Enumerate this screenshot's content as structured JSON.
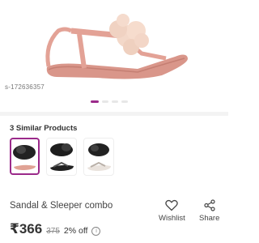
{
  "product": {
    "sku": "s-172636357",
    "title": "Sandal & Sleeper combo",
    "price": "₹366",
    "mrp": "375",
    "discount": "2% off",
    "info_glyph": "i"
  },
  "gallery": {
    "image_count": 4,
    "active_index": 0
  },
  "similar": {
    "title": "3 Similar Products",
    "thumbs": [
      {
        "name": "similar-product-1",
        "selected": true
      },
      {
        "name": "similar-product-2",
        "selected": false
      },
      {
        "name": "similar-product-3",
        "selected": false
      }
    ]
  },
  "actions": {
    "wishlist_label": "Wishlist",
    "share_label": "Share",
    "wishlist_icon": "heart-outline-icon",
    "share_icon": "share-icon"
  },
  "colors": {
    "accent": "#9b2a8a",
    "sandal": "#e3a296"
  }
}
